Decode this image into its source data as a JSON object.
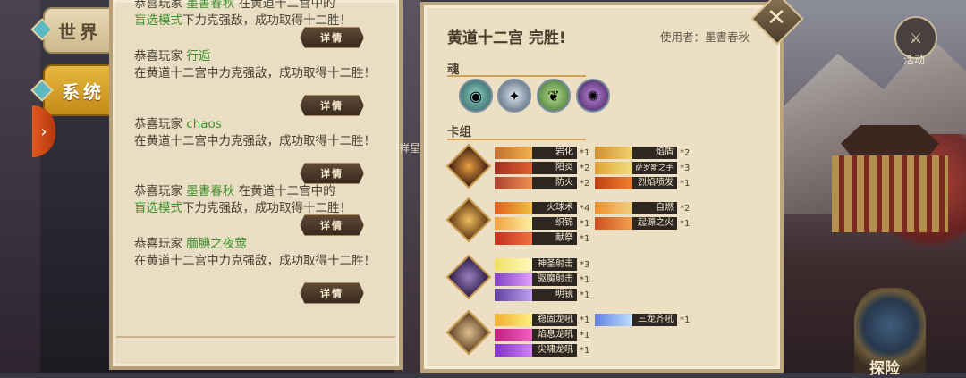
{
  "tabs": {
    "world": "世界",
    "system": "系统"
  },
  "side_label": "祥星",
  "messages": [
    {
      "prefix": "恭喜玩家",
      "name": "墨書春秋",
      "line1_rest": "在黄道十二宫中的",
      "mode": "盲选模式",
      "line2_rest": "下力克强敌，成功取得十二胜！",
      "detail": "详情"
    },
    {
      "prefix": "恭喜玩家",
      "name": "行逅",
      "body": "在黄道十二宫中力克强敌，成功取得十二胜！",
      "detail": "详情"
    },
    {
      "prefix": "恭喜玩家",
      "name": "chaos",
      "body": "在黄道十二宫中力克强敌，成功取得十二胜！",
      "detail": "详情"
    },
    {
      "prefix": "恭喜玩家",
      "name": "墨書春秋",
      "line1_rest": "在黄道十二宫中的",
      "mode": "盲选模式",
      "line2_rest": "下力克强敌，成功取得十二胜！",
      "detail": "详情"
    },
    {
      "prefix": "恭喜玩家",
      "name": "腼腆之夜莺",
      "body": "在黄道十二宫中力克强敌，成功取得十二胜！",
      "detail": "详情"
    }
  ],
  "detail_panel": {
    "title": "黄道十二宫 完胜!",
    "user": "使用者：墨書春秋",
    "soul_label": "魂",
    "deck_label": "卡组",
    "souls": [
      "soul-green-icon",
      "soul-silver-icon",
      "soul-bamboo-icon",
      "soul-purple-icon"
    ],
    "groups": [
      {
        "hero": "hero-fire-icon",
        "cards": [
          {
            "name": "岩化",
            "count": "*1",
            "col": 0
          },
          {
            "name": "阳炎",
            "count": "*2",
            "col": 0
          },
          {
            "name": "防火",
            "count": "*2",
            "col": 0
          },
          {
            "name": "焰盾",
            "count": "*2",
            "col": 1
          },
          {
            "name": "萨罗斯之手",
            "count": "*3",
            "col": 1
          },
          {
            "name": "烈焰喷发",
            "count": "*1",
            "col": 1
          }
        ]
      },
      {
        "hero": "hero-mage-icon",
        "cards": [
          {
            "name": "火球术",
            "count": "*4",
            "col": 0
          },
          {
            "name": "织锦",
            "count": "*1",
            "col": 0
          },
          {
            "name": "献祭",
            "count": "*1",
            "col": 0
          },
          {
            "name": "自燃",
            "count": "*2",
            "col": 1
          },
          {
            "name": "起源之火",
            "count": "*1",
            "col": 1
          }
        ]
      },
      {
        "hero": "hero-shadow-icon",
        "cards": [
          {
            "name": "神圣射击",
            "count": "*3",
            "col": 0
          },
          {
            "name": "驱魔射击",
            "count": "*1",
            "col": 0
          },
          {
            "name": "明镜",
            "count": "*1",
            "col": 0
          }
        ]
      },
      {
        "hero": "hero-dragon-icon",
        "cards": [
          {
            "name": "稳固龙吼",
            "count": "*1",
            "col": 0
          },
          {
            "name": "焰息龙吼",
            "count": "*1",
            "col": 0
          },
          {
            "name": "尖啸龙吼",
            "count": "*1",
            "col": 0
          },
          {
            "name": "三龙齐吼",
            "count": "*1",
            "col": 1
          }
        ]
      }
    ]
  },
  "hud": {
    "activity": "活动",
    "explore": "探险"
  },
  "colors": {
    "accent_gold": "#cfa25a",
    "name_green": "#3f8f2c",
    "panel_bg": "#ecdfc4"
  }
}
